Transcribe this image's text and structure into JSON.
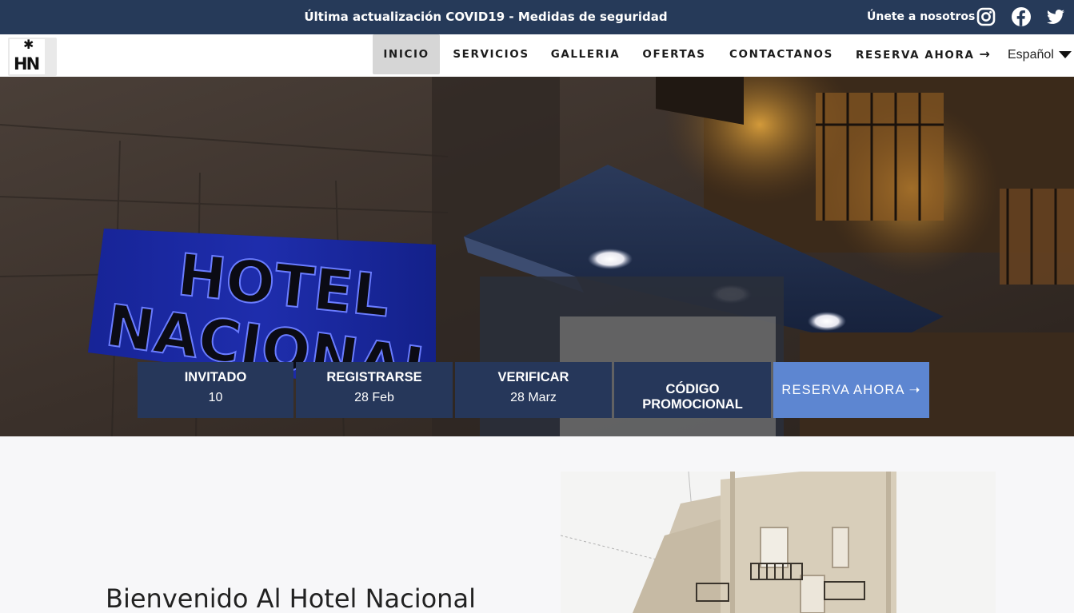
{
  "topbar": {
    "notice": "Última actualización COVID19 - Medidas de seguridad",
    "join_label": "Únete a nosotros",
    "social_icons": [
      "instagram-icon",
      "facebook-icon",
      "twitter-icon"
    ],
    "background_color": "#263a59"
  },
  "nav": {
    "logo_text": "HN",
    "items": [
      {
        "label": "INICIO",
        "active": true
      },
      {
        "label": "SERVICIOS",
        "active": false
      },
      {
        "label": "GALLERIA",
        "active": false
      },
      {
        "label": "OFERTAS",
        "active": false
      },
      {
        "label": "CONTACTANOS",
        "active": false
      },
      {
        "label": "RESERVA AHORA",
        "active": false
      }
    ],
    "reserve_arrow": "→",
    "language": "Español"
  },
  "hero": {
    "sign_line1": "HOTEL",
    "sign_line2": "NACIONAL"
  },
  "booking": {
    "guests_label": "INVITADO",
    "guests_value": "10",
    "checkin_label": "REGISTRARSE",
    "checkin_value": "28 Feb",
    "checkout_label": "VERIFICAR",
    "checkout_value": "28 Marz",
    "promo_label": "CÓDIGO PROMOCIONAL",
    "cta_label": "RESERVA AHORA ➝",
    "panel_color": "#26375a",
    "cta_color": "#5d86d1"
  },
  "intro": {
    "title": "Bienvenido Al Hotel Nacional"
  }
}
